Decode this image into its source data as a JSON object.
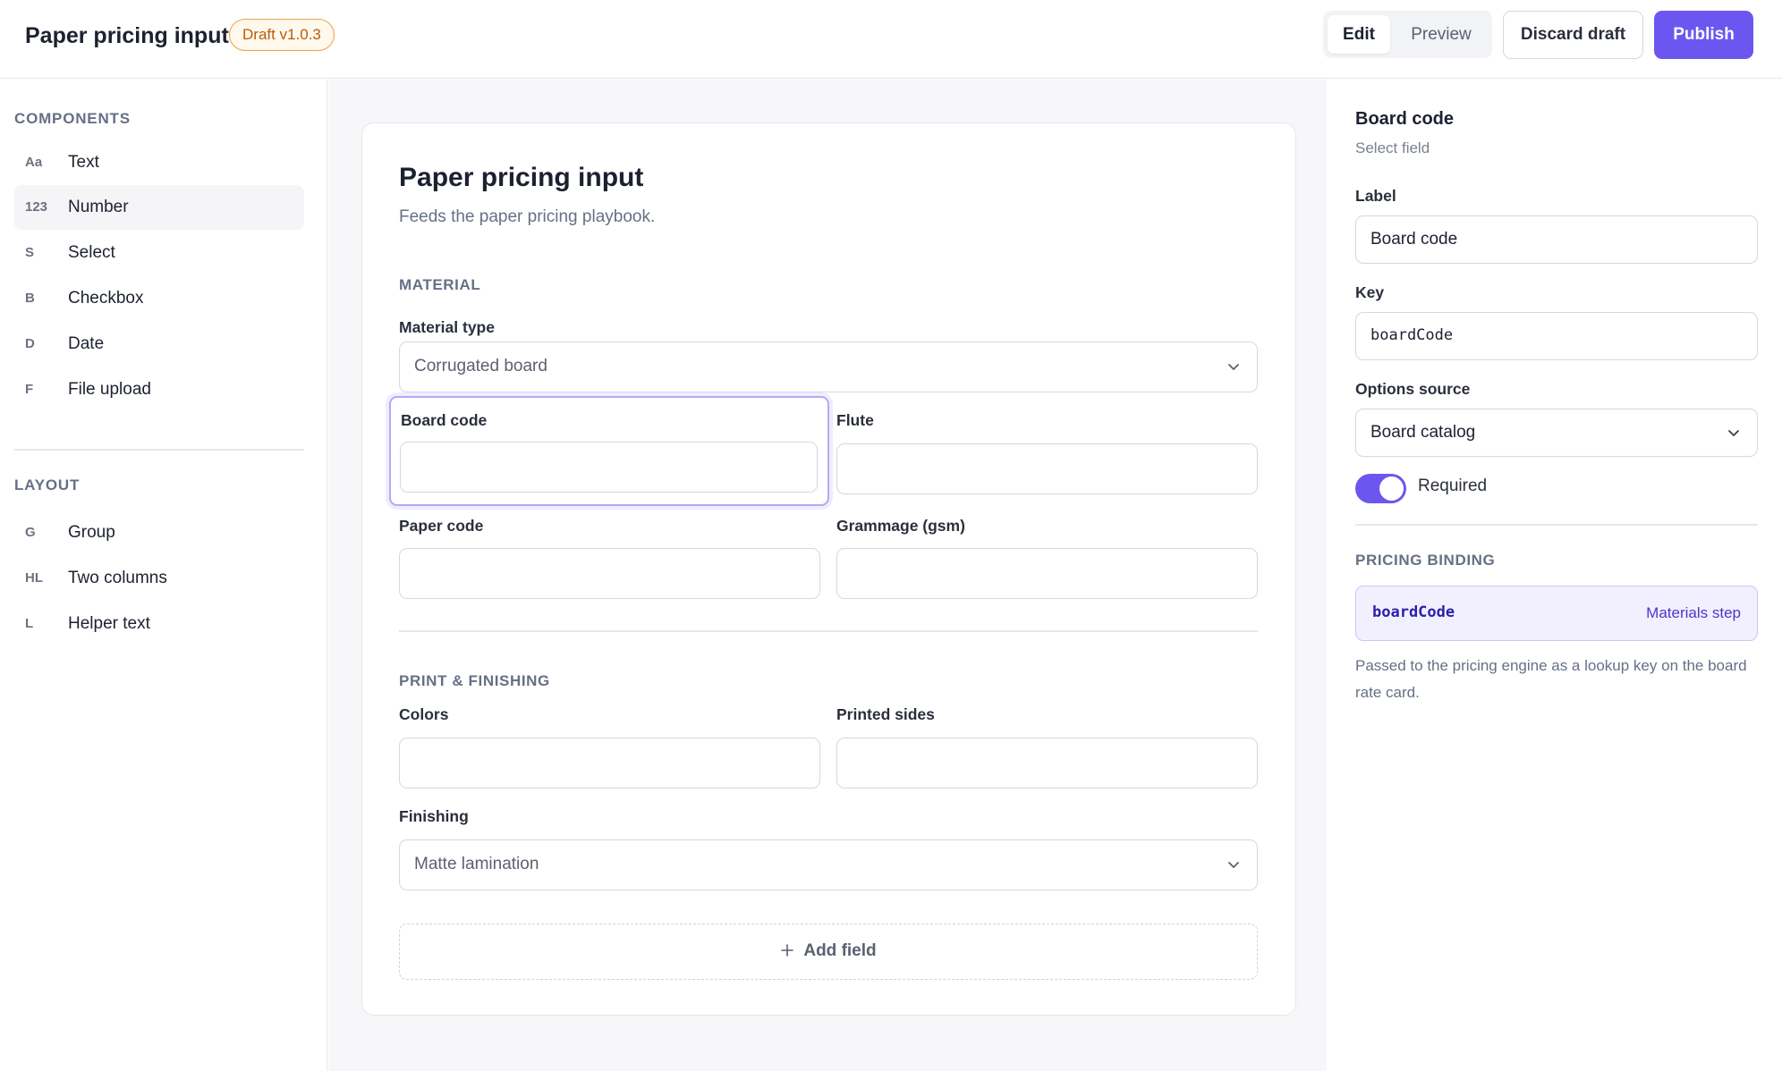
{
  "header": {
    "title": "Paper pricing input",
    "badge": "Draft v1.0.3",
    "mode_edit": "Edit",
    "mode_preview": "Preview",
    "discard_label": "Discard draft",
    "publish_label": "Publish"
  },
  "colors": {
    "accent": "#6b57f0",
    "badge_text": "#b85c0c"
  },
  "sidebar": {
    "components_heading": "COMPONENTS",
    "components": [
      {
        "abbr": "Aa",
        "label": "Text"
      },
      {
        "abbr": "123",
        "label": "Number",
        "active": true
      },
      {
        "abbr": "S",
        "label": "Select"
      },
      {
        "abbr": "B",
        "label": "Checkbox"
      },
      {
        "abbr": "D",
        "label": "Date"
      },
      {
        "abbr": "F",
        "label": "File upload"
      }
    ],
    "layout_heading": "LAYOUT",
    "layout": [
      {
        "abbr": "G",
        "label": "Group"
      },
      {
        "abbr": "HL",
        "label": "Two columns"
      },
      {
        "abbr": "L",
        "label": "Helper text"
      }
    ]
  },
  "form": {
    "title": "Paper pricing input",
    "subtitle": "Feeds the paper pricing playbook.",
    "material": {
      "heading": "MATERIAL",
      "material_type_label": "Material type",
      "material_type_value": "Corrugated board",
      "board_code_label": "Board code",
      "flute_label": "Flute",
      "paper_code_label": "Paper code",
      "grammage_label": "Grammage (gsm)"
    },
    "print": {
      "heading": "PRINT & FINISHING",
      "colors_label": "Colors",
      "printed_sides_label": "Printed sides",
      "finishing_label": "Finishing",
      "finishing_value": "Matte lamination"
    },
    "add_field_label": "Add field"
  },
  "inspector": {
    "title": "Board code",
    "subtitle": "Select field",
    "label_label": "Label",
    "label_value": "Board code",
    "key_label": "Key",
    "key_value": "boardCode",
    "options_source_label": "Options source",
    "options_source_value": "Board catalog",
    "required_label": "Required",
    "required_on": true,
    "binding_heading": "PRICING BINDING",
    "binding_key": "boardCode",
    "binding_step": "Materials step",
    "binding_note": "Passed to the pricing engine as a lookup key on the board rate card."
  }
}
